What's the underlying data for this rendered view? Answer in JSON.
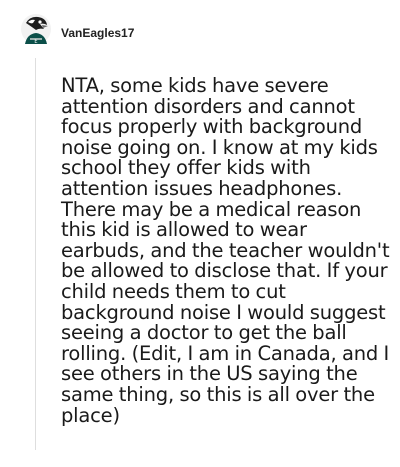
{
  "comment": {
    "username": "VanEagles17",
    "avatar_icon": "eagle-avatar-icon",
    "body": "NTA, some kids have severe attention disorders and cannot focus properly with background noise going on. I know at my kids school they offer kids with attention issues headphones. There may be a medical reason this kid is allowed to wear earbuds, and the teacher wouldn't be allowed to disclose that. If your child needs them to cut background noise I would suggest seeing a doctor to get the ball rolling. (Edit, I am in Canada, and I see others in the US saying the same thing, so this is all over the place)"
  },
  "colors": {
    "background": "#ffffff",
    "text": "#1a1a1a",
    "thread_line": "#dedede"
  }
}
